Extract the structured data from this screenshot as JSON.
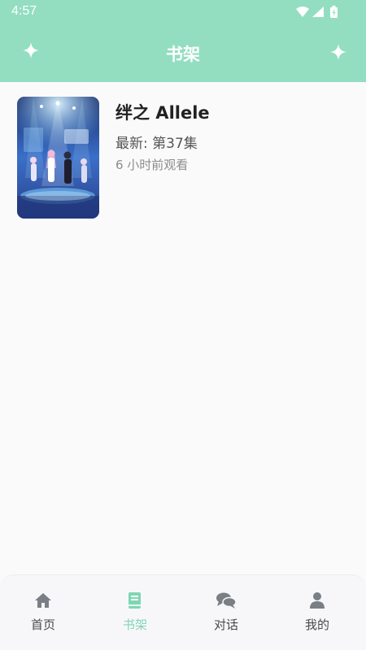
{
  "colors": {
    "header_bg": "#93dec1",
    "accent": "#7fd6b4",
    "icon_gray": "#7a7f86",
    "text_dark": "#222222"
  },
  "status_bar": {
    "time": "4:57",
    "icons": [
      "wifi-icon",
      "signal-icon",
      "battery-charging-icon"
    ]
  },
  "header": {
    "title": "书架",
    "left_icon": "sparkle-icon",
    "right_icon": "sparkle-icon"
  },
  "bookshelf": {
    "items": [
      {
        "title": "绊之 Allele",
        "latest": "最新: 第37集",
        "last_watched": "6 小时前观看",
        "cover_icon": "anime-cover-image"
      }
    ]
  },
  "bottom_nav": {
    "items": [
      {
        "label": "首页",
        "icon": "home-icon",
        "active": false
      },
      {
        "label": "书架",
        "icon": "book-icon",
        "active": true
      },
      {
        "label": "对话",
        "icon": "chat-bubbles-icon",
        "active": false
      },
      {
        "label": "我的",
        "icon": "user-icon",
        "active": false
      }
    ]
  }
}
